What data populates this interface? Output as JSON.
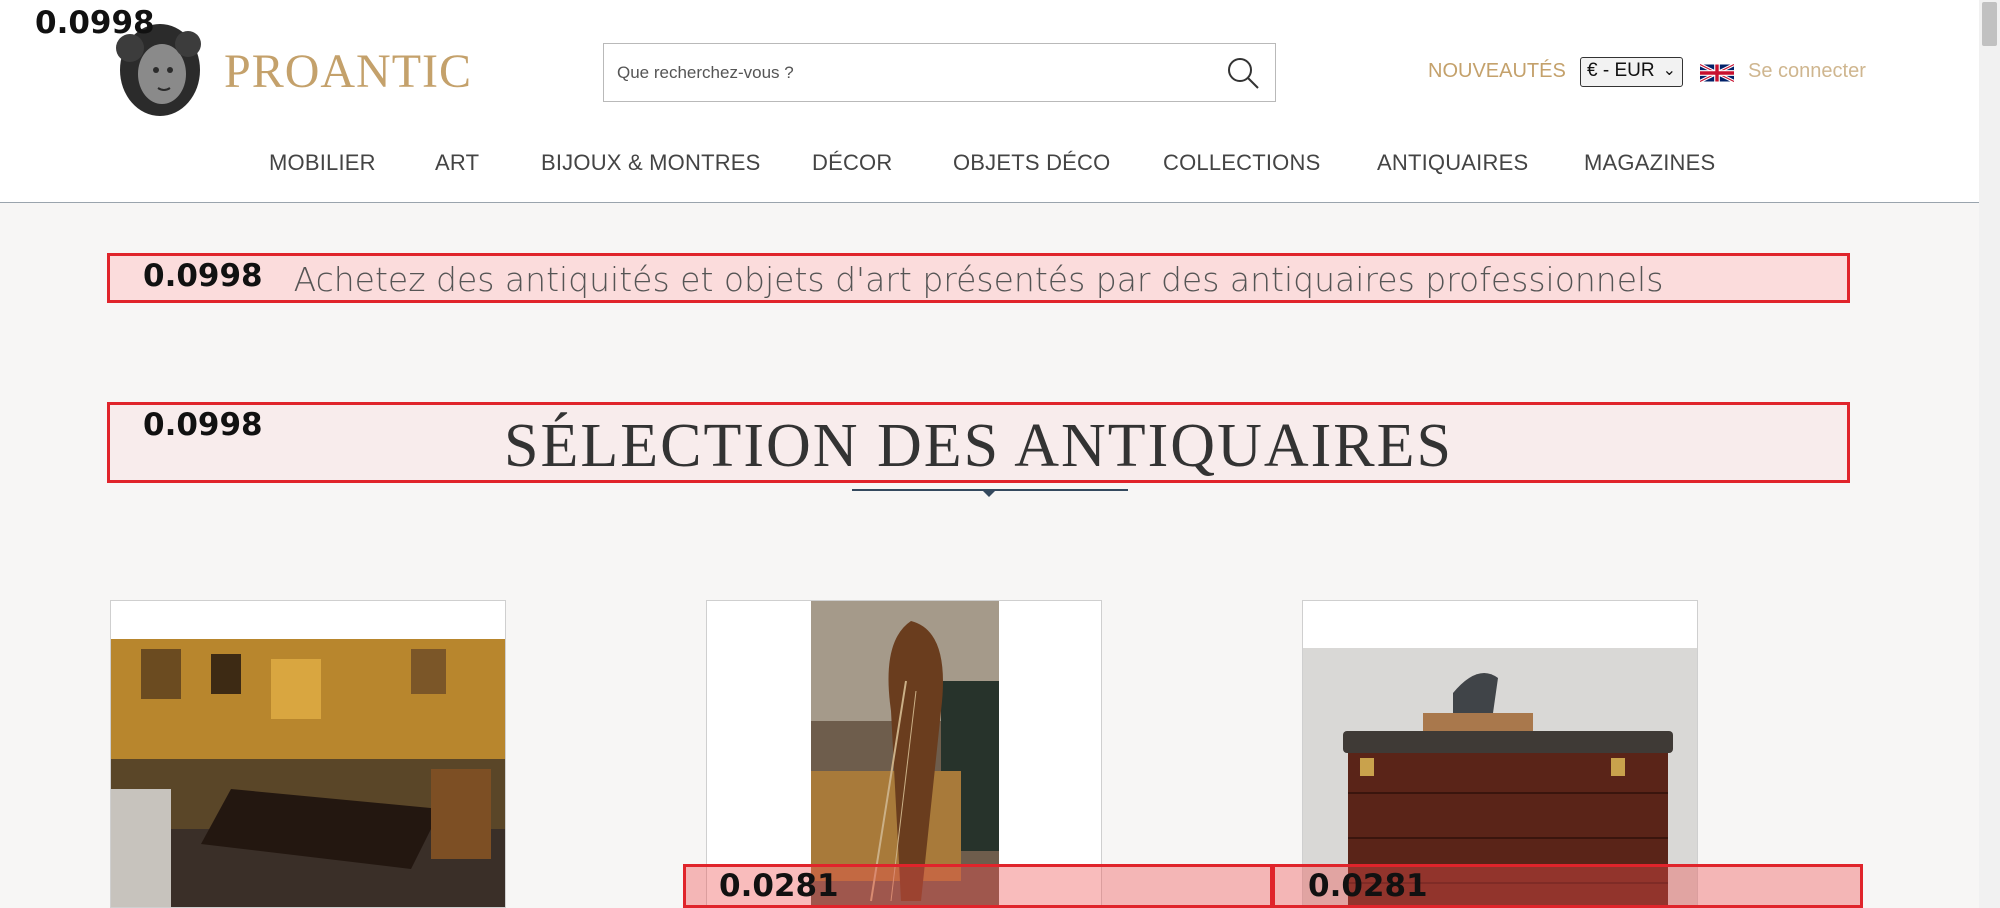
{
  "header": {
    "logo_text": "PROANTIC",
    "logo_icon": "marble-head-logo",
    "search_placeholder": "Que recherchez-vous ?",
    "nouveautes": "NOUVEAUTÉS",
    "currency": "€ - EUR",
    "language_flag": "uk-flag-icon",
    "login": "Se connecter",
    "top_score": "0.0998"
  },
  "nav": [
    "MOBILIER",
    "ART",
    "BIJOUX & MONTRES",
    "DÉCOR",
    "OBJETS DÉCO",
    "COLLECTIONS",
    "ANTIQUAIRES",
    "MAGAZINES"
  ],
  "tagline": {
    "score": "0.0998",
    "text": "Achetez des antiquités et objets d'art présentés par des antiquaires professionnels"
  },
  "section": {
    "score": "0.0998",
    "title": "SÉLECTION DES ANTIQUAIRES"
  },
  "cards": [
    {
      "image": "antique-shop-interior"
    },
    {
      "image": "carved-harp"
    },
    {
      "image": "mahogany-commode-with-deer-statue"
    }
  ],
  "bottom_scores": [
    "0.0281",
    "0.0281"
  ],
  "colors": {
    "gold": "#c4a16b",
    "overlay_red": "#e0242b"
  }
}
